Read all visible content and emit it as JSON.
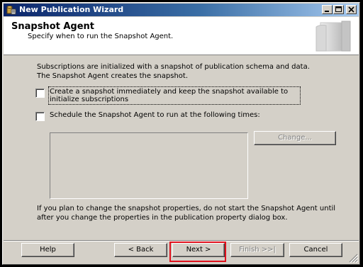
{
  "window": {
    "title": "New Publication Wizard"
  },
  "header": {
    "title": "Snapshot Agent",
    "subtitle": "Specify when to run the Snapshot Agent."
  },
  "body": {
    "intro": "Subscriptions are initialized with a snapshot of publication schema and data. The Snapshot Agent creates the snapshot.",
    "option_create": {
      "label": "Create a snapshot immediately and keep the snapshot available to initialize subscriptions",
      "checked": false
    },
    "option_schedule": {
      "label": "Schedule the Snapshot Agent to run at the following times:",
      "checked": false
    },
    "change_button": "Change...",
    "note": "If you plan to change the snapshot properties, do not start the Snapshot Agent until after you change the properties in the publication property dialog box."
  },
  "footer": {
    "help": "Help",
    "back": "< Back",
    "next": "Next >",
    "finish": "Finish >>|",
    "cancel": "Cancel"
  },
  "colors": {
    "title_bar": "#0a246a",
    "highlight": "#e0101c"
  }
}
